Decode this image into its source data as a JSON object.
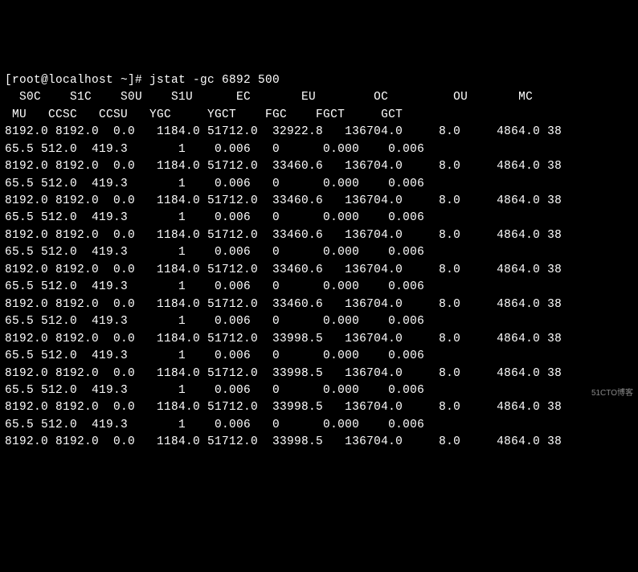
{
  "prompt": "[root@localhost ~]# ",
  "command": "jstat -gc 6892 500",
  "header1": "  S0C    S1C    S0U    S1U      EC       EU        OC         OU       MC",
  "header2": " MU   CCSC   CCSU   YGC     YGCT    FGC    FGCT     GCT",
  "rows": [
    {
      "a": "8192.0 8192.0  0.0   1184.0 51712.0  32922.8   136704.0     8.0     4864.0 38",
      "b": "65.5 512.0  419.3       1    0.006   0      0.000    0.006"
    },
    {
      "a": "8192.0 8192.0  0.0   1184.0 51712.0  33460.6   136704.0     8.0     4864.0 38",
      "b": "65.5 512.0  419.3       1    0.006   0      0.000    0.006"
    },
    {
      "a": "8192.0 8192.0  0.0   1184.0 51712.0  33460.6   136704.0     8.0     4864.0 38",
      "b": "65.5 512.0  419.3       1    0.006   0      0.000    0.006"
    },
    {
      "a": "8192.0 8192.0  0.0   1184.0 51712.0  33460.6   136704.0     8.0     4864.0 38",
      "b": "65.5 512.0  419.3       1    0.006   0      0.000    0.006"
    },
    {
      "a": "8192.0 8192.0  0.0   1184.0 51712.0  33460.6   136704.0     8.0     4864.0 38",
      "b": "65.5 512.0  419.3       1    0.006   0      0.000    0.006"
    },
    {
      "a": "8192.0 8192.0  0.0   1184.0 51712.0  33460.6   136704.0     8.0     4864.0 38",
      "b": "65.5 512.0  419.3       1    0.006   0      0.000    0.006"
    },
    {
      "a": "8192.0 8192.0  0.0   1184.0 51712.0  33998.5   136704.0     8.0     4864.0 38",
      "b": "65.5 512.0  419.3       1    0.006   0      0.000    0.006"
    },
    {
      "a": "8192.0 8192.0  0.0   1184.0 51712.0  33998.5   136704.0     8.0     4864.0 38",
      "b": "65.5 512.0  419.3       1    0.006   0      0.000    0.006"
    },
    {
      "a": "8192.0 8192.0  0.0   1184.0 51712.0  33998.5   136704.0     8.0     4864.0 38",
      "b": "65.5 512.0  419.3       1    0.006   0      0.000    0.006"
    },
    {
      "a": "8192.0 8192.0  0.0   1184.0 51712.0  33998.5   136704.0     8.0     4864.0 38",
      "b": ""
    }
  ],
  "watermark": "51CTO博客"
}
